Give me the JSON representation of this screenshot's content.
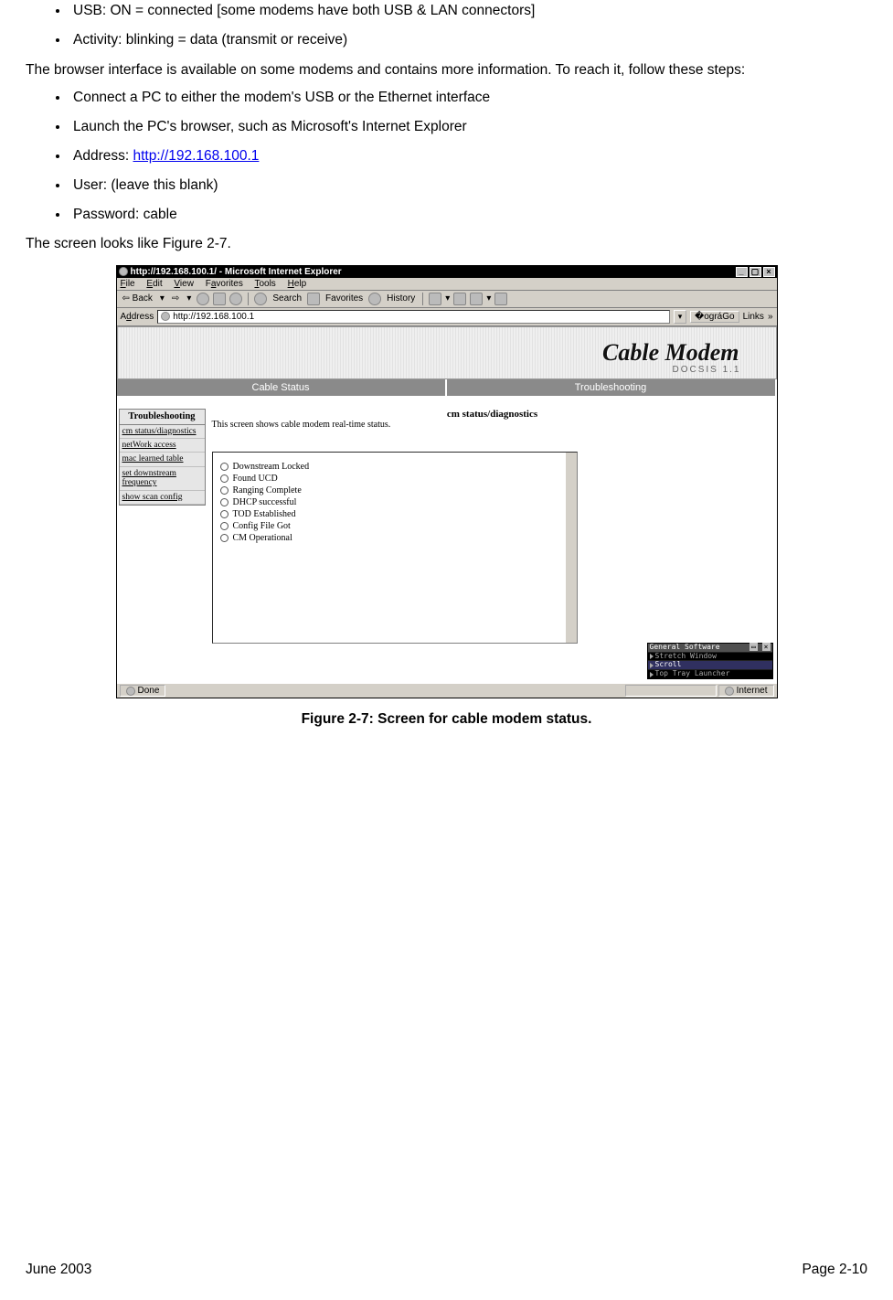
{
  "bullets_top": [
    "USB: ON = connected [some modems have both USB & LAN connectors]",
    "Activity: blinking = data (transmit or receive)"
  ],
  "para1": "The browser interface is available on some modems and contains more information.  To reach it, follow these steps:",
  "bullets_steps": [
    "Connect a PC to either the modem's USB or the Ethernet interface",
    "Launch the PC's browser, such as Microsoft's Internet Explorer"
  ],
  "addr_prefix": "Address: ",
  "addr_url": "http://192.168.100.1",
  "bullets_steps2": [
    "User: (leave this blank)",
    "Password: cable"
  ],
  "para2": "The screen looks like Figure 2-7.",
  "figure_caption": "Figure 2-7: Screen for cable modem status.",
  "footer": {
    "left": "June 2003",
    "right": "Page 2-10"
  },
  "ie": {
    "title": "http://192.168.100.1/ - Microsoft Internet Explorer",
    "menus": [
      "File",
      "Edit",
      "View",
      "Favorites",
      "Tools",
      "Help"
    ],
    "tb": {
      "back": "Back",
      "search": "Search",
      "favorites": "Favorites",
      "history": "History"
    },
    "addr_label": "Address",
    "addr_value": "http://192.168.100.1",
    "go": "Go",
    "links": "Links",
    "banner_title": "Cable Modem",
    "banner_sub": "DOCSIS 1.1",
    "tabs": [
      "Cable Status",
      "Troubleshooting"
    ],
    "side_header": "Troubleshooting",
    "side_items": [
      "cm status/diagnostics",
      "netWork access",
      "mac learned table",
      "set downstream frequency",
      "show scan config"
    ],
    "panel_title": "cm status/diagnostics",
    "panel_desc": "This screen shows cable modem real-time status.",
    "status_items": [
      "Downstream Locked",
      "Found UCD",
      "Ranging Complete",
      "DHCP successful",
      "TOD Established",
      "Config File Got",
      "CM Operational"
    ],
    "overlay": {
      "title": "General Software",
      "rows": [
        "Stretch Window",
        "Scroll",
        "Top Tray Launcher"
      ]
    },
    "status_left": "Done",
    "status_right": "Internet"
  }
}
